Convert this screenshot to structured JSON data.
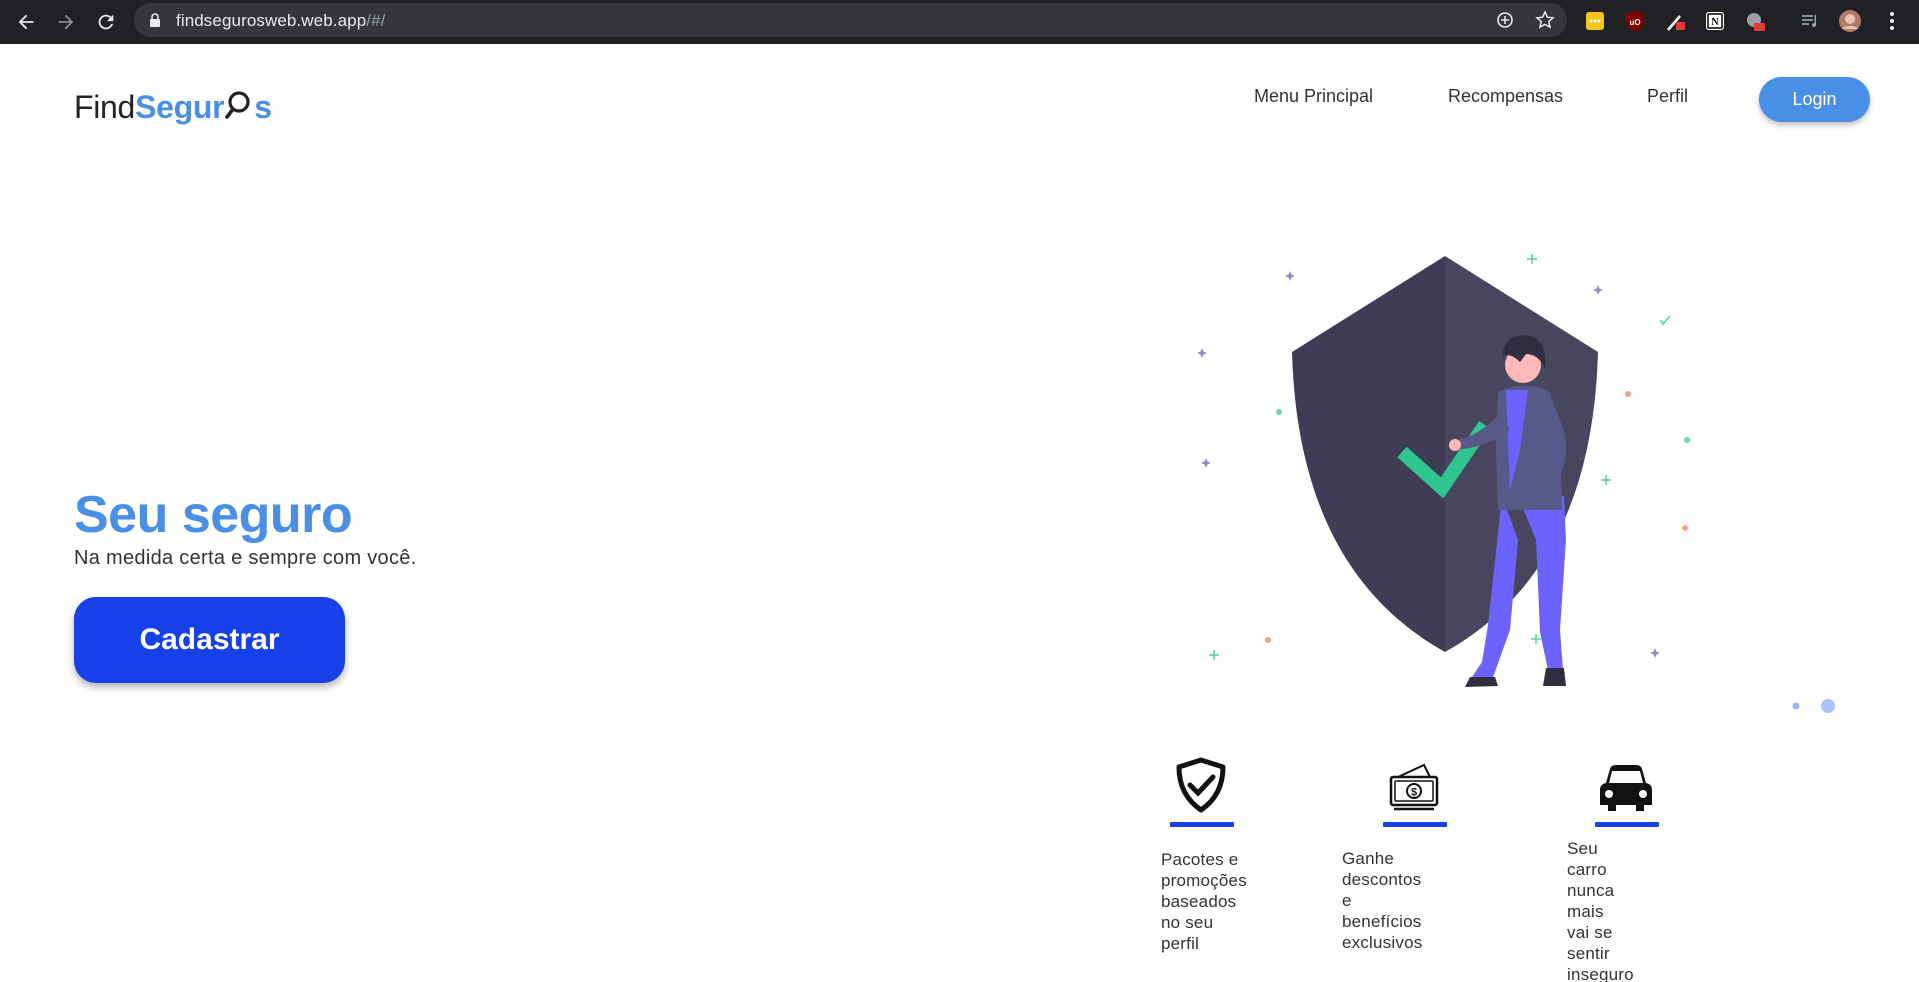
{
  "browser": {
    "url_host": "findsegurosweb.web.app",
    "url_path": "/#/"
  },
  "header": {
    "logo": {
      "part1": "Find",
      "part2": "Segur",
      "part3": "s"
    },
    "nav": [
      "Menu Principal",
      "Recompensas",
      "Perfil"
    ],
    "login_label": "Login"
  },
  "hero": {
    "title": "Seu seguro",
    "subtitle": "Na medida certa e sempre com você.",
    "cta_label": "Cadastrar"
  },
  "features": [
    {
      "icon": "shield-check-icon",
      "text": [
        "Pacotes e",
        "promoções",
        "baseados",
        "no seu perfil"
      ]
    },
    {
      "icon": "money-icon",
      "text": [
        "Ganhe descontos",
        "e benefícios",
        "exclusivos"
      ]
    },
    {
      "icon": "car-icon",
      "text": [
        "Seu carro",
        "nunca mais",
        "vai se sentir",
        "inseguro"
      ]
    }
  ],
  "colors": {
    "brand_blue": "#4a8fe7",
    "cta_blue": "#1641e8",
    "shield_dark": "#3f3d56",
    "check_green": "#2fc58f",
    "person_purple": "#6c63ff"
  }
}
